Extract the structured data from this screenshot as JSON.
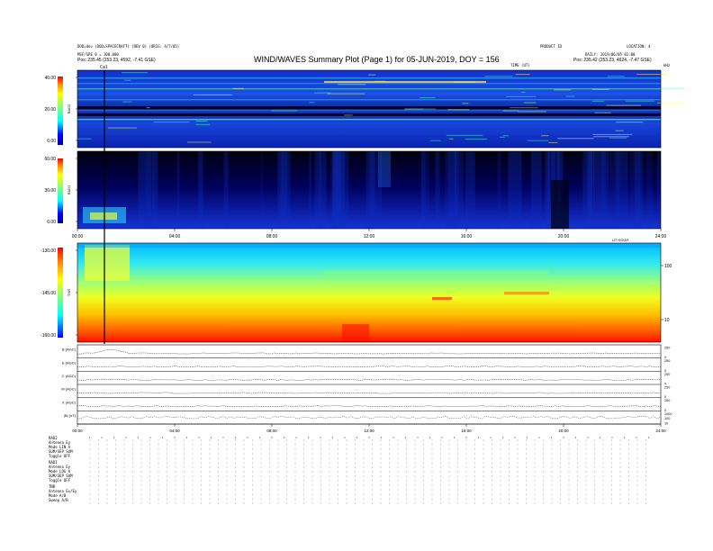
{
  "header": {
    "left_line1": "DOD=dev (DOD=SPACECRAFT) (REV 0) (ORIG: 4/7/05)",
    "left_line2": "MSF/SPE 0 = 100.000",
    "left_pos": "Pos: 235.45 (253.23, 4592, -7.41 GSE)",
    "title": "WIND/WAVES Summary Plot (Page 1) for 05-JUN-2019, DOY = 156",
    "right_top1": "PRODUCT ID",
    "right_top2": "LOCATION: 4",
    "right_line3": "DAILY: 2019/06/05 02:00",
    "right_pos": "Pos: 235.42 (253.23, 4624, -7.47 GSE)",
    "time_label": "TIME (UT)",
    "hz_label": "kHz",
    "cal_marker": "Cal"
  },
  "chart_data": [
    {
      "type": "heatmap",
      "panel": "RAD2",
      "ylabel": "RAD2",
      "yticks": [
        "40.00",
        "20.00",
        "0.00"
      ],
      "ylim": [
        0,
        40
      ],
      "xlim": [
        0,
        24
      ],
      "colorscale": "jet"
    },
    {
      "type": "heatmap",
      "panel": "RAD1",
      "ylabel": "RAD1",
      "yticks": [
        "60.00",
        "30.00",
        "0.00"
      ],
      "ylim": [
        0,
        60
      ],
      "xticks": [
        "00:00",
        "04:00",
        "08:00",
        "12:00",
        "16:00",
        "20:00",
        "24:00"
      ],
      "xtick_values": [
        0,
        4,
        8,
        12,
        16,
        20,
        24
      ],
      "xunit": "UT HOUR",
      "xlim": [
        0,
        24
      ],
      "colorscale": "jet"
    },
    {
      "type": "heatmap",
      "panel": "TNR",
      "ylabel": "TNR",
      "yticks": [
        "-130.00",
        "-145.00",
        "-160.00"
      ],
      "ylim": [
        -160,
        -130
      ],
      "right_ticks": [
        "100",
        "10"
      ],
      "xlim": [
        0,
        24
      ],
      "colorscale": "jet"
    },
    {
      "type": "line",
      "panel": "stack",
      "rows": [
        {
          "name": "B (AGC)",
          "right_ticks": [
            "250",
            "0"
          ]
        },
        {
          "name": "E (AGC)",
          "right_ticks": [
            "250",
            "0"
          ]
        },
        {
          "name": "C (AGC)",
          "right_ticks": [
            "250",
            "0"
          ]
        },
        {
          "name": "M (AGC)",
          "right_ticks": [
            "250",
            "0"
          ]
        },
        {
          "name": "X (AGC)",
          "right_ticks": [
            "250",
            "0"
          ]
        },
        {
          "name": "|B| (nT)",
          "right_ticks": [
            "1000",
            "100",
            "10"
          ]
        }
      ],
      "xticks": [
        "00:00",
        "04:00",
        "08:00",
        "12:00",
        "16:00",
        "20:00",
        "24:00"
      ],
      "xtick_values": [
        0,
        4,
        8,
        12,
        16,
        20,
        24
      ],
      "xlim": [
        0,
        24
      ]
    }
  ],
  "bottom_table": {
    "rad2_title": "RAD2",
    "rad2_rows": [
      "Antenna   Ey",
      "Mode   LIN A",
      "SUM/SEP   SUM",
      "Toggle   OFF"
    ],
    "rad1_title": "RAD1",
    "rad1_rows": [
      "Antenna   Ey",
      "Mode   LOG A",
      "SUM/SEP   SUM",
      "Toggle   OFF"
    ],
    "tnr_title": "TNR",
    "tnr_rows": [
      "Antenna   Ex/Ey",
      "Mode   A/B",
      "Sweep   A/B"
    ]
  }
}
